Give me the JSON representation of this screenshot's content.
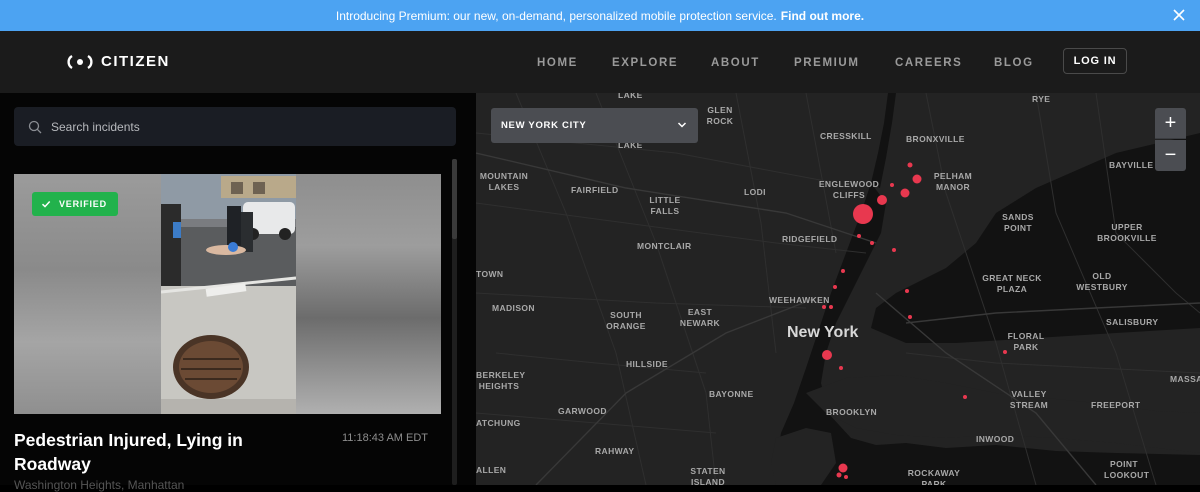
{
  "banner": {
    "text": "Introducing Premium: our new, on-demand, personalized mobile protection service.",
    "link": "Find out more.",
    "close_icon": "close-icon"
  },
  "nav": {
    "brand": "CITIZEN",
    "links": [
      "HOME",
      "EXPLORE",
      "ABOUT",
      "PREMIUM",
      "CAREERS",
      "BLOG"
    ],
    "login": "LOG IN"
  },
  "sidebar": {
    "search_placeholder": "Search incidents",
    "incident": {
      "badge": "VERIFIED",
      "title": "Pedestrian Injured, Lying in Roadway",
      "time": "11:18:43 AM EDT",
      "location": "Washington Heights, Manhattan"
    }
  },
  "map": {
    "city_selector": "NEW YORK CITY",
    "zoom_in": "+",
    "zoom_out": "−",
    "accent_color": "#e8384f",
    "labels": {
      "lake_top": "LAKE",
      "glen_rock": "GLEN ROCK",
      "rye": "RYE",
      "lake_2": "LAKE",
      "cresskill": "CRESSKILL",
      "bronxville": "BRONXVILLE",
      "bayville": "BAYVILLE",
      "mountain_lakes": "MOUNTAIN LAKES",
      "fairfield": "FAIRFIELD",
      "little_falls": "LITTLE FALLS",
      "lodi": "LODI",
      "englewood_cliffs": "ENGLEWOOD CLIFFS",
      "pelham_manor": "PELHAM MANOR",
      "sands_point": "SANDS POINT",
      "upper_brookville": "UPPER BROOKVILLE",
      "montclair": "MONTCLAIR",
      "ridgefield": "RIDGEFIELD",
      "town": "TOWN",
      "great_neck_plaza": "GREAT NECK PLAZA",
      "old_westbury": "OLD WESTBURY",
      "madison": "MADISON",
      "weehawken": "WEEHAWKEN",
      "south_orange": "SOUTH ORANGE",
      "east_newark": "EAST NEWARK",
      "salisbury": "SALISBURY",
      "new_york": "New York",
      "floral_park": "FLORAL PARK",
      "hillside": "HILLSIDE",
      "berkeley_heights": "BERKELEY HEIGHTS",
      "massa": "MASSA",
      "bayonne": "BAYONNE",
      "valley_stream": "VALLEY STREAM",
      "freeport": "FREEPORT",
      "garwood": "GARWOOD",
      "brooklyn": "BROOKLYN",
      "inwood": "INWOOD",
      "atchung": "ATCHUNG",
      "rahway": "RAHWAY",
      "allen": "ALLEN",
      "staten_island": "STATEN ISLAND",
      "rockaway_park": "ROCKAWAY PARK",
      "point_lookout": "POINT LOOKOUT"
    }
  }
}
